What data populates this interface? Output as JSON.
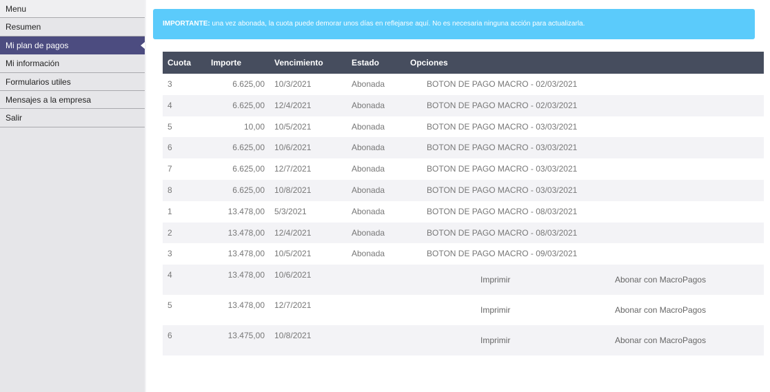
{
  "sidebar": {
    "items": [
      {
        "label": "Menu"
      },
      {
        "label": "Resumen"
      },
      {
        "label": "Mi plan de pagos"
      },
      {
        "label": "Mi información"
      },
      {
        "label": "Formularios utiles"
      },
      {
        "label": "Mensajes a la empresa"
      },
      {
        "label": "Salir"
      }
    ]
  },
  "alert": {
    "strong": "IMPORTANTE:",
    "text": " una vez abonada, la cuota puede demorar unos días en reflejarse aquí. No es necesaria ninguna acción para actualizarla."
  },
  "table": {
    "headers": {
      "cuota": "Cuota",
      "importe": "Importe",
      "vencimiento": "Vencimiento",
      "estado": "Estado",
      "opciones": "Opciones"
    },
    "paid_rows": [
      {
        "cuota": "3",
        "importe": "6.625,00",
        "vencimiento": "10/3/2021",
        "estado": "Abonada",
        "opciones": "BOTON DE PAGO MACRO - 02/03/2021"
      },
      {
        "cuota": "4",
        "importe": "6.625,00",
        "vencimiento": "12/4/2021",
        "estado": "Abonada",
        "opciones": "BOTON DE PAGO MACRO - 02/03/2021"
      },
      {
        "cuota": "5",
        "importe": "10,00",
        "vencimiento": "10/5/2021",
        "estado": "Abonada",
        "opciones": "BOTON DE PAGO MACRO - 03/03/2021"
      },
      {
        "cuota": "6",
        "importe": "6.625,00",
        "vencimiento": "10/6/2021",
        "estado": "Abonada",
        "opciones": "BOTON DE PAGO MACRO - 03/03/2021"
      },
      {
        "cuota": "7",
        "importe": "6.625,00",
        "vencimiento": "12/7/2021",
        "estado": "Abonada",
        "opciones": "BOTON DE PAGO MACRO - 03/03/2021"
      },
      {
        "cuota": "8",
        "importe": "6.625,00",
        "vencimiento": "10/8/2021",
        "estado": "Abonada",
        "opciones": "BOTON DE PAGO MACRO - 03/03/2021"
      },
      {
        "cuota": "1",
        "importe": "13.478,00",
        "vencimiento": "5/3/2021",
        "estado": "Abonada",
        "opciones": "BOTON DE PAGO MACRO - 08/03/2021"
      },
      {
        "cuota": "2",
        "importe": "13.478,00",
        "vencimiento": "12/4/2021",
        "estado": "Abonada",
        "opciones": "BOTON DE PAGO MACRO - 08/03/2021"
      },
      {
        "cuota": "3",
        "importe": "13.478,00",
        "vencimiento": "10/5/2021",
        "estado": "Abonada",
        "opciones": "BOTON DE PAGO MACRO - 09/03/2021"
      }
    ],
    "pending_rows": [
      {
        "cuota": "4",
        "importe": "13.478,00",
        "vencimiento": "10/6/2021",
        "imprimir": "Imprimir",
        "abonar": "Abonar con MacroPagos"
      },
      {
        "cuota": "5",
        "importe": "13.478,00",
        "vencimiento": "12/7/2021",
        "imprimir": "Imprimir",
        "abonar": "Abonar con MacroPagos"
      },
      {
        "cuota": "6",
        "importe": "13.475,00",
        "vencimiento": "10/8/2021",
        "imprimir": "Imprimir",
        "abonar": "Abonar con MacroPagos"
      }
    ]
  }
}
